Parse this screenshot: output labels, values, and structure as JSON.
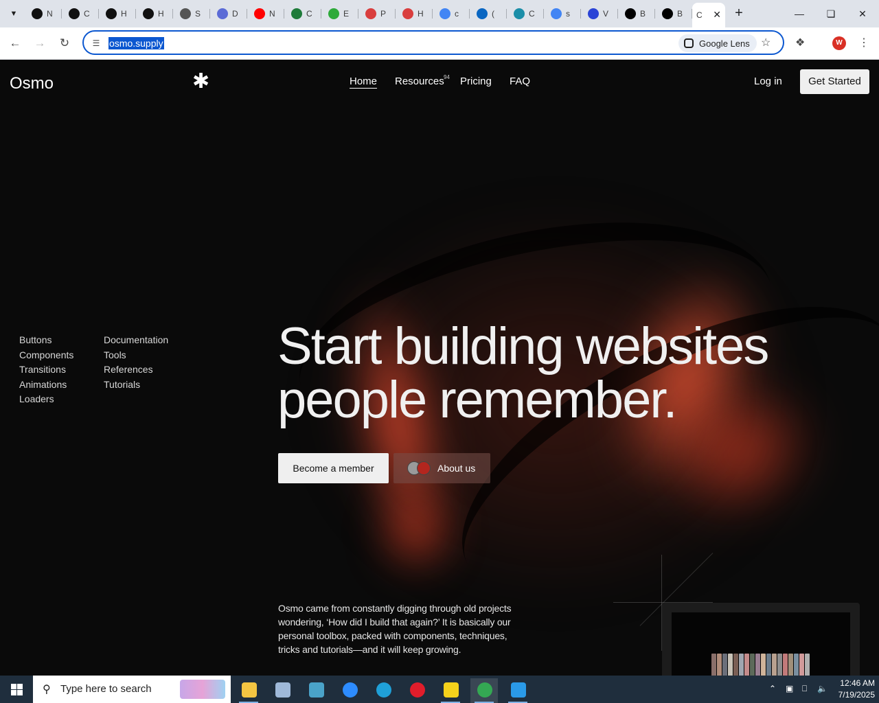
{
  "browser": {
    "tabs": [
      {
        "letter": "N",
        "icon": "openai-icon",
        "color": "#111111"
      },
      {
        "letter": "C",
        "icon": "openai-icon",
        "color": "#111111"
      },
      {
        "letter": "H",
        "icon": "openai-icon",
        "color": "#111111"
      },
      {
        "letter": "H",
        "icon": "openai-icon",
        "color": "#111111"
      },
      {
        "letter": "S",
        "icon": "wordpress-icon",
        "color": "#555555"
      },
      {
        "letter": "D",
        "icon": "dribbble-like-icon",
        "color": "#5b6bd6"
      },
      {
        "letter": "N",
        "icon": "youtube-icon",
        "color": "#ff0000"
      },
      {
        "letter": "C",
        "icon": "webflow-icon",
        "color": "#1e7b3a"
      },
      {
        "letter": "E",
        "icon": "envato-icon",
        "color": "#2eaa3a"
      },
      {
        "letter": "P",
        "icon": "ticket-icon",
        "color": "#d93e3e"
      },
      {
        "letter": "H",
        "icon": "ticket-icon",
        "color": "#d93e3e"
      },
      {
        "letter": "c",
        "icon": "google-icon",
        "color": "#4285f4"
      },
      {
        "letter": "(",
        "icon": "linkedin-icon",
        "color": "#0a66c2"
      },
      {
        "letter": "C",
        "icon": "cube-icon",
        "color": "#1b8ea8"
      },
      {
        "letter": "s",
        "icon": "google-icon",
        "color": "#4285f4"
      },
      {
        "letter": "V",
        "icon": "x-logo-icon",
        "color": "#2b44d6"
      },
      {
        "letter": "B",
        "icon": "x-logo-icon",
        "color": "#000000"
      },
      {
        "letter": "B",
        "icon": "x-logo-icon",
        "color": "#000000"
      }
    ],
    "active_tab": {
      "letter": "C"
    },
    "url": "osmo.supply",
    "lens_label": "Google Lens",
    "profile_initial": "W"
  },
  "site": {
    "logo": "Osmo",
    "nav": {
      "home": "Home",
      "resources": "Resources",
      "resources_count": "94",
      "pricing": "Pricing",
      "faq": "FAQ"
    },
    "login": "Log in",
    "get_started": "Get Started",
    "categories_left": [
      "Buttons",
      "Components",
      "Transitions",
      "Animations",
      "Loaders"
    ],
    "categories_right": [
      "Documentation",
      "Tools",
      "References",
      "Tutorials"
    ],
    "hero_line1": "Start building websites",
    "hero_line2": "people remember.",
    "become_member": "Become a member",
    "about_us": "About us",
    "description": "Osmo came from constantly digging through old projects wondering, ‘How did I build that again?’ It is basically our personal toolbox, packed with components, techniques, tricks and tutorials—and it will keep growing.",
    "accent": "#ff5a36"
  },
  "taskbar": {
    "search_placeholder": "Type here to search",
    "time": "12:46 AM",
    "date": "7/19/2025",
    "apps": [
      {
        "name": "file-explorer-icon",
        "color": "#f4c542"
      },
      {
        "name": "app-icon",
        "color": "#9fb9d9"
      },
      {
        "name": "app-icon",
        "color": "#4aa3c9"
      },
      {
        "name": "zoom-icon",
        "color": "#2d8cff"
      },
      {
        "name": "edge-icon",
        "color": "#1fa0d8"
      },
      {
        "name": "opera-icon",
        "color": "#e11d2b"
      },
      {
        "name": "sticky-notes-icon",
        "color": "#f5d21b"
      },
      {
        "name": "chrome-icon",
        "color": "#34a853"
      },
      {
        "name": "vscode-icon",
        "color": "#2a9ae8"
      }
    ]
  }
}
